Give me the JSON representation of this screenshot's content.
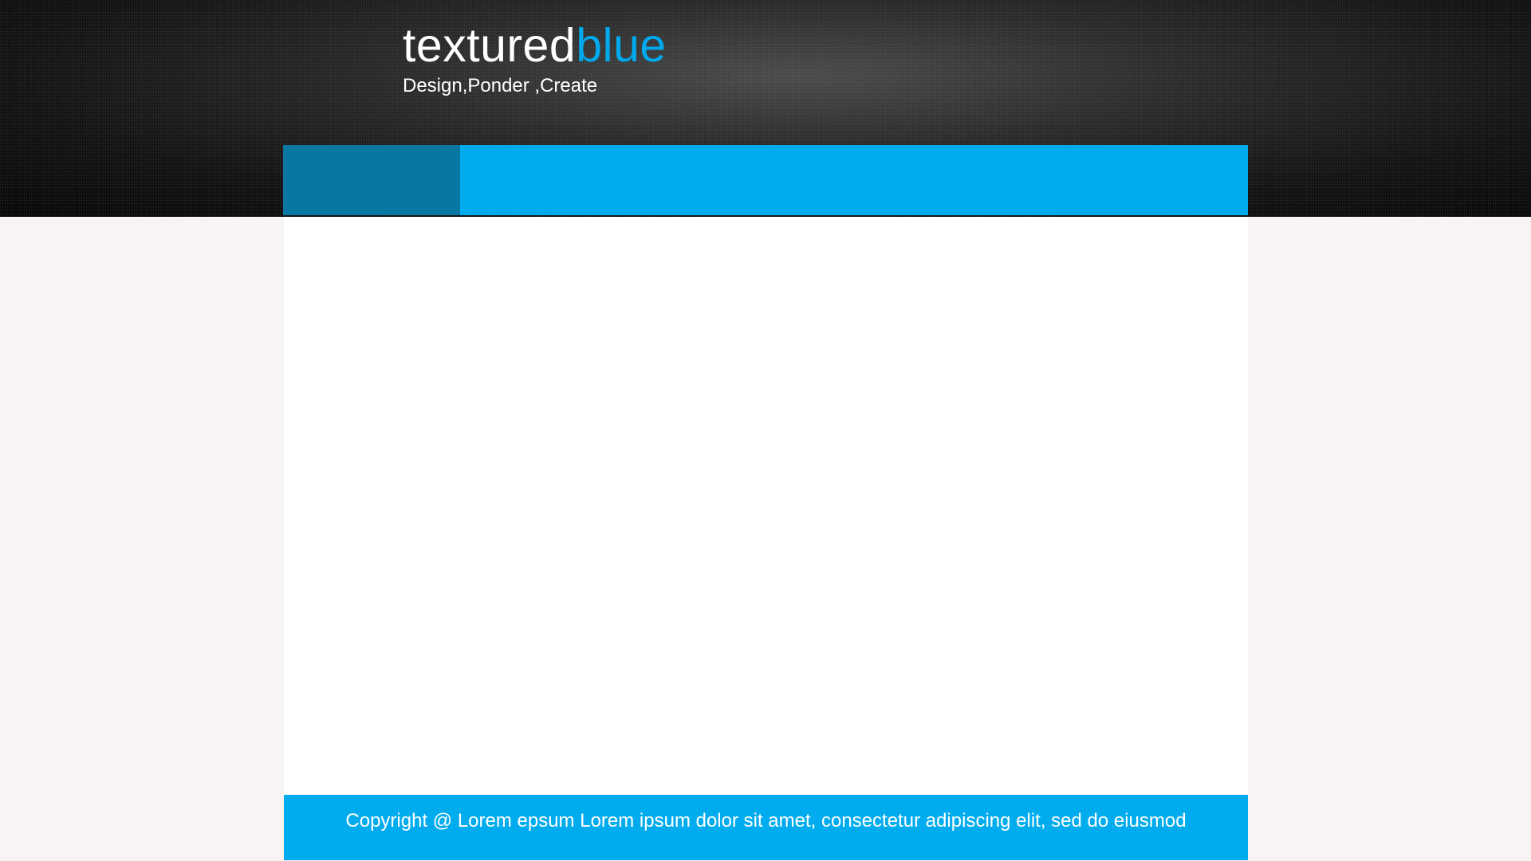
{
  "header": {
    "brand_main": "textured",
    "brand_accent": "blue",
    "tagline": "Design,Ponder ,Create"
  },
  "footer": {
    "copyright": "Copyright @ Lorem epsum Lorem ipsum dolor sit amet, consectetur adipiscing elit, sed do eiusmod"
  },
  "colors": {
    "accent": "#00acee",
    "active_nav": "#0878a2",
    "page_background": "#f7f4f3"
  }
}
